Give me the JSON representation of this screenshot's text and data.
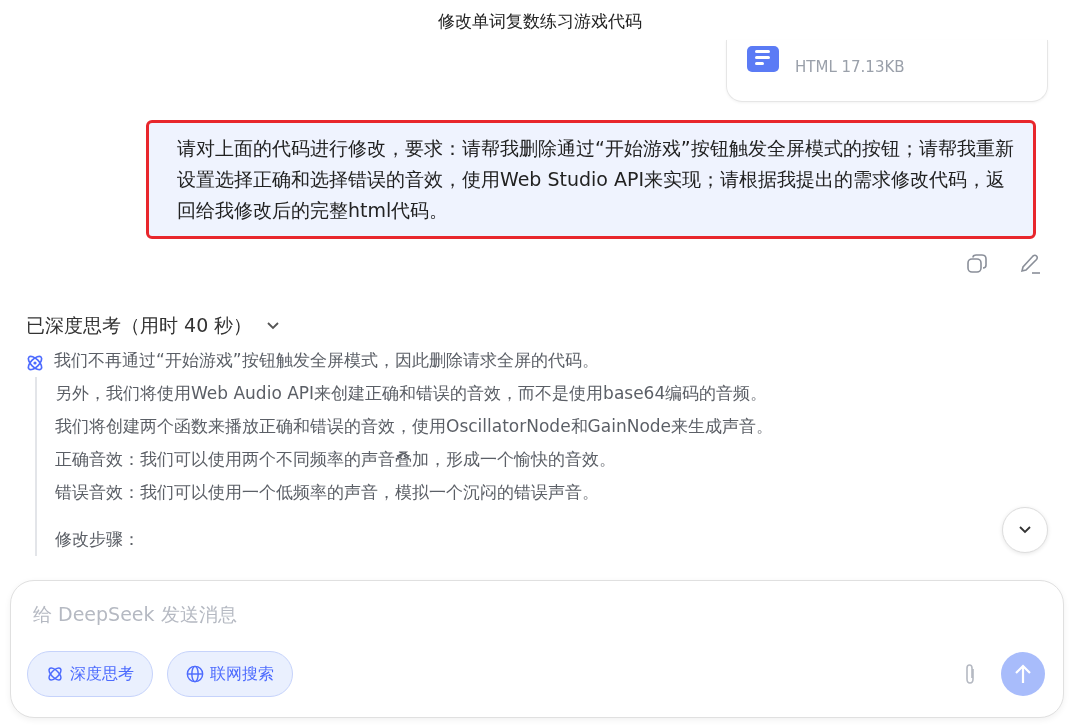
{
  "window": {
    "title": "修改单词复数练习游戏代码"
  },
  "attachment": {
    "meta": "HTML 17.13KB"
  },
  "user_message": {
    "text": "请对上面的代码进行修改，要求：请帮我删除通过“开始游戏”按钮触发全屏模式的按钮；请帮我重新设置选择正确和选择错误的音效，使用Web Studio API来实现；请根据我提出的需求修改代码，返回给我修改后的完整html代码。",
    "highlighted": true
  },
  "thinking": {
    "header": "已深度思考（用时 40 秒）",
    "expanded": true,
    "lines": [
      "我们不再通过“开始游戏”按钮触发全屏模式，因此删除请求全屏的代码。",
      "另外，我们将使用Web Audio API来创建正确和错误的音效，而不是使用base64编码的音频。",
      "我们将创建两个函数来播放正确和错误的音效，使用OscillatorNode和GainNode来生成声音。",
      "正确音效：我们可以使用两个不同频率的声音叠加，形成一个愉快的音效。",
      "错误音效：我们可以使用一个低频率的声音，模拟一个沉闷的错误声音。",
      "修改步骤："
    ]
  },
  "composer": {
    "placeholder": "给 DeepSeek 发送消息",
    "toggles": [
      {
        "label": "深度思考",
        "kind": "think",
        "selected": true
      },
      {
        "label": "联网搜索",
        "kind": "search",
        "selected": true
      }
    ]
  }
}
